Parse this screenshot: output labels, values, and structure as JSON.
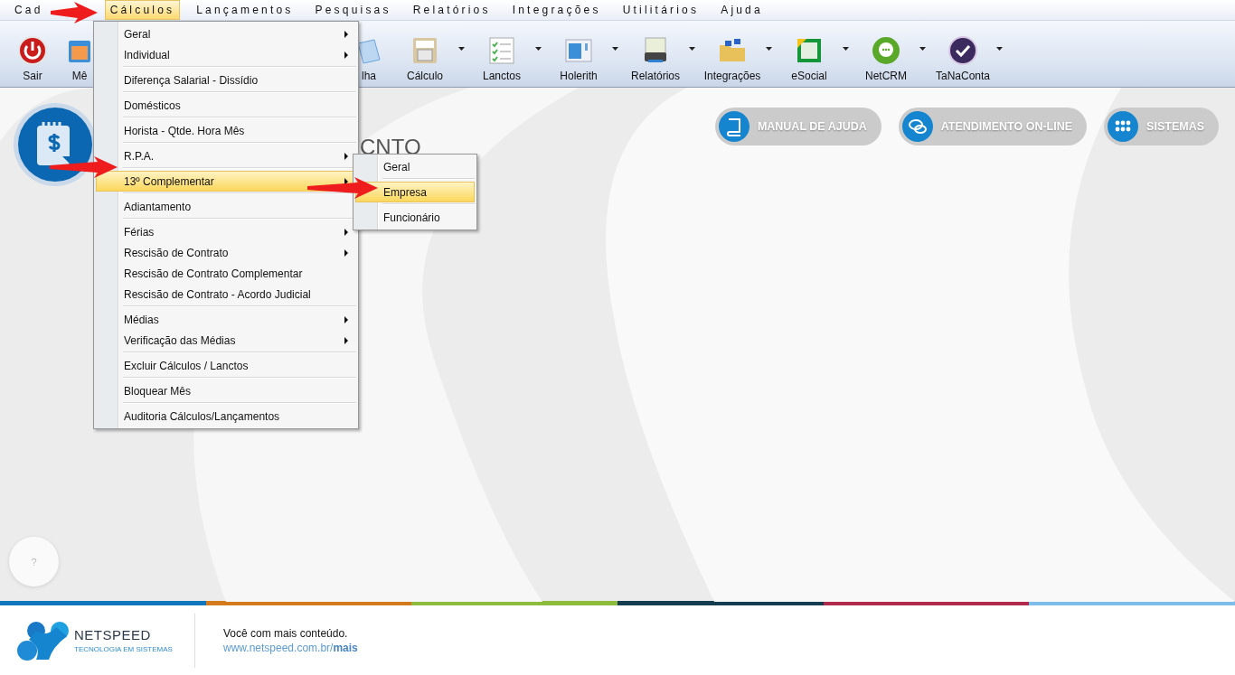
{
  "menubar": [
    {
      "label": "Cad",
      "selected": false
    },
    {
      "label": "Cálculos",
      "selected": true
    },
    {
      "label": "Lançamentos",
      "selected": false
    },
    {
      "label": "Pesquisas",
      "selected": false
    },
    {
      "label": "Relatórios",
      "selected": false
    },
    {
      "label": "Integrações",
      "selected": false
    },
    {
      "label": "Utilitários",
      "selected": false
    },
    {
      "label": "Ajuda",
      "selected": false
    }
  ],
  "toolbar": [
    {
      "label": "Sair",
      "dropdown": false
    },
    {
      "label": "Mê"
    },
    {
      "label": "lha",
      "dropdown": false
    },
    {
      "label": "Cálculo",
      "dropdown": true
    },
    {
      "label": "Lanctos",
      "dropdown": true
    },
    {
      "label": "Holerith",
      "dropdown": true
    },
    {
      "label": "Relatórios",
      "dropdown": true
    },
    {
      "label": "Integrações",
      "dropdown": true
    },
    {
      "label": "eSocial",
      "dropdown": true
    },
    {
      "label": "NetCRM",
      "dropdown": true
    },
    {
      "label": "TaNaConta",
      "dropdown": true
    }
  ],
  "menu": {
    "groups": [
      [
        {
          "label": "Geral",
          "submenu": true,
          "selected": false
        },
        {
          "label": "Individual",
          "submenu": true,
          "selected": false
        }
      ],
      [
        {
          "label": "Diferença Salarial - Dissídio",
          "submenu": false,
          "selected": false
        }
      ],
      [
        {
          "label": "Domésticos",
          "submenu": false,
          "selected": false
        }
      ],
      [
        {
          "label": "Horista - Qtde. Hora Mês",
          "submenu": false,
          "selected": false
        }
      ],
      [
        {
          "label": "R.P.A.",
          "submenu": true,
          "selected": false
        }
      ],
      [
        {
          "label": "13º Complementar",
          "submenu": true,
          "selected": true
        }
      ],
      [
        {
          "label": "Adiantamento",
          "submenu": false,
          "selected": false
        }
      ],
      [
        {
          "label": "Férias",
          "submenu": true,
          "selected": false
        },
        {
          "label": "Rescisão de Contrato",
          "submenu": true,
          "selected": false
        },
        {
          "label": "Rescisão de Contrato Complementar",
          "submenu": false,
          "selected": false
        },
        {
          "label": "Rescisão de Contrato - Acordo Judicial",
          "submenu": false,
          "selected": false
        }
      ],
      [
        {
          "label": "Médias",
          "submenu": true,
          "selected": false
        },
        {
          "label": "Verificação das Médias",
          "submenu": true,
          "selected": false
        }
      ],
      [
        {
          "label": "Excluir Cálculos / Lanctos",
          "submenu": false,
          "selected": false
        }
      ],
      [
        {
          "label": "Bloquear Mês",
          "submenu": false,
          "selected": false
        }
      ],
      [
        {
          "label": "Auditoria Cálculos/Lançamentos",
          "submenu": false,
          "selected": false
        }
      ]
    ]
  },
  "submenu": {
    "items": [
      {
        "label": "Geral",
        "selected": false
      },
      {
        "label": "Empresa",
        "selected": true
      },
      {
        "label": "Funcionário",
        "selected": false
      }
    ]
  },
  "page_title": "CNTO",
  "action_buttons": [
    {
      "label": "MANUAL DE AJUDA"
    },
    {
      "label": "ATENDIMENTO ON-LINE"
    },
    {
      "label": "SISTEMAS"
    }
  ],
  "help_button": "?",
  "footer": {
    "brand": "NETSPEED",
    "tagline": "TECNOLOGIA EM SISTEMAS",
    "message": "Você com mais conteúdo.",
    "link": "www.netspeed.com.br/**mais**"
  }
}
